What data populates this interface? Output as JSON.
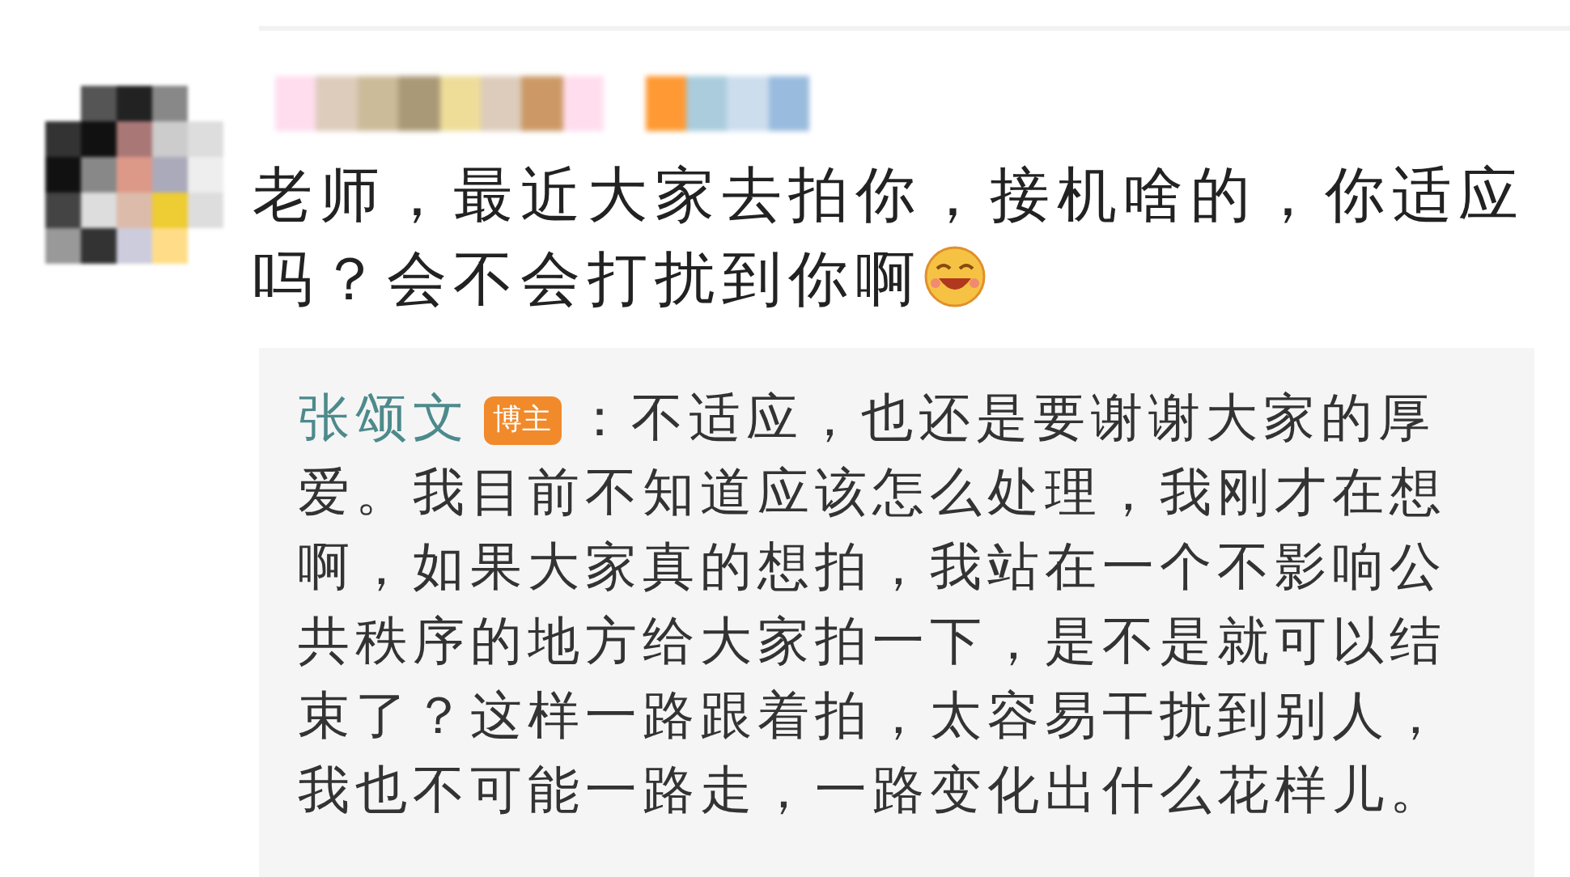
{
  "comment": {
    "text": "老师，最近大家去拍你，接机啥的，你适应吗？会不会打扰到你啊",
    "reply": {
      "author": "张颂文",
      "badge": "博主",
      "text": "：不适应，也还是要谢谢大家的厚爱。我目前不知道应该怎么处理，我刚才在想啊，如果大家真的想拍，我站在一个不影响公共秩序的地方给大家拍一下，是不是就可以结束了？这样一路跟着拍，太容易干扰到别人，我也不可能一路走，一路变化出什么花样儿。"
    }
  }
}
